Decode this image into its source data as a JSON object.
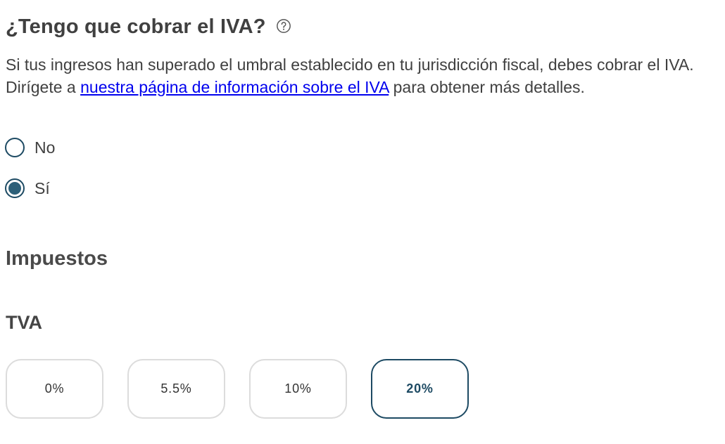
{
  "question": {
    "title": "¿Tengo que cobrar el IVA?",
    "help_icon": "question-circle-icon",
    "description_before": "Si tus ingresos han superado el umbral establecido en tu jurisdicción fiscal, debes cobrar el IVA. Dirígete a ",
    "description_link": "nuestra página de información sobre el IVA",
    "description_after": " para obtener más detalles."
  },
  "options": {
    "no_label": "No",
    "si_label": "Sí",
    "selected": "Sí"
  },
  "section": {
    "title": "Impuestos",
    "tax_name": "TVA"
  },
  "rates": {
    "items": [
      "0%",
      "5.5%",
      "10%",
      "20%"
    ],
    "selected": "20%"
  },
  "colors": {
    "accent": "#1d4a63",
    "radio_fill": "#2c5f78",
    "link": "#0000ee",
    "border": "#dcdcdc"
  }
}
